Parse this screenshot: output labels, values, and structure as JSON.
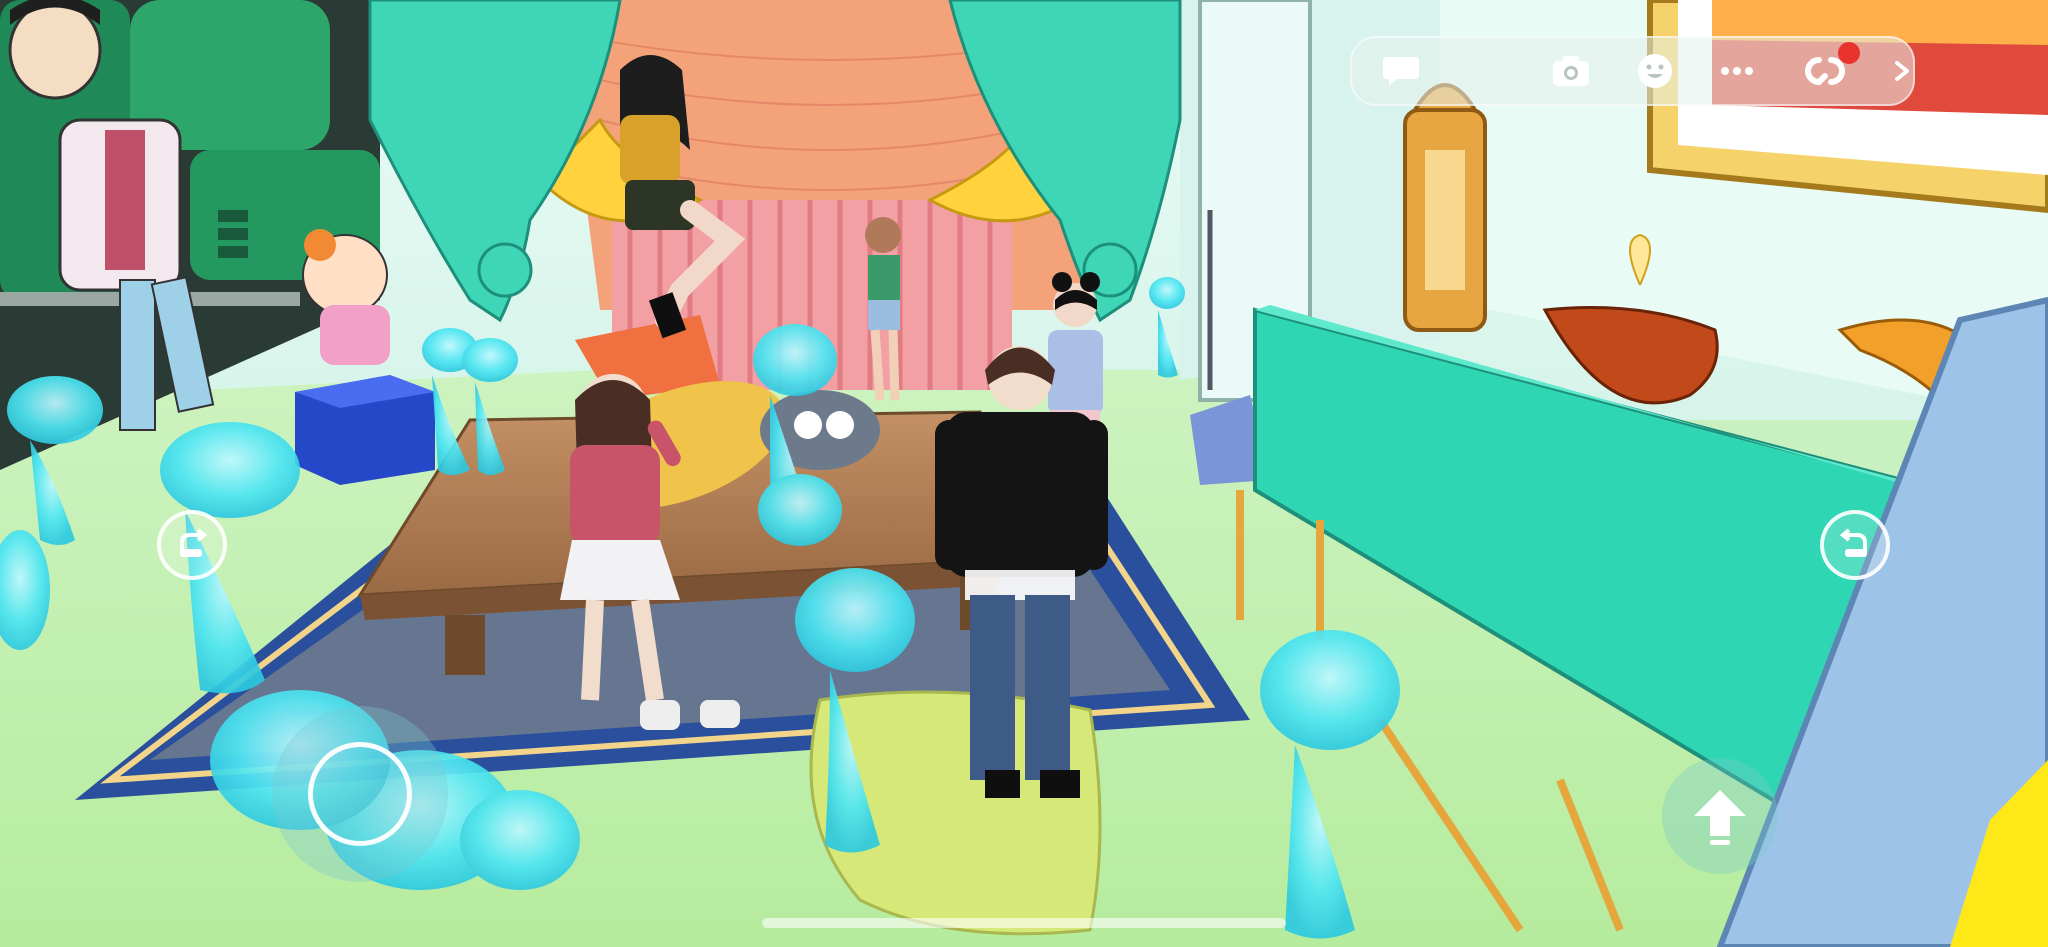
{
  "hud": {
    "toolbar": [
      {
        "name": "chat-icon"
      },
      {
        "name": "camera-icon"
      },
      {
        "name": "emote-icon"
      },
      {
        "name": "more-icon"
      },
      {
        "name": "link-icon"
      },
      {
        "name": "expand-icon"
      }
    ],
    "has_notification": true
  },
  "controls": {
    "left_camera": "rotate-camera-icon",
    "right_camera": "rotate-camera-icon",
    "joystick": "joystick-icon",
    "jump": "jump-arrow-icon"
  },
  "colors": {
    "floor": "#c8f0c0",
    "wall": "#e6f8f4",
    "curtain": "#3fd6b8",
    "tablecloth": "#2fd6b4",
    "ghost": "#4ee6f2",
    "rug": "#2a4f9c",
    "accent_red": "#e8342c"
  }
}
